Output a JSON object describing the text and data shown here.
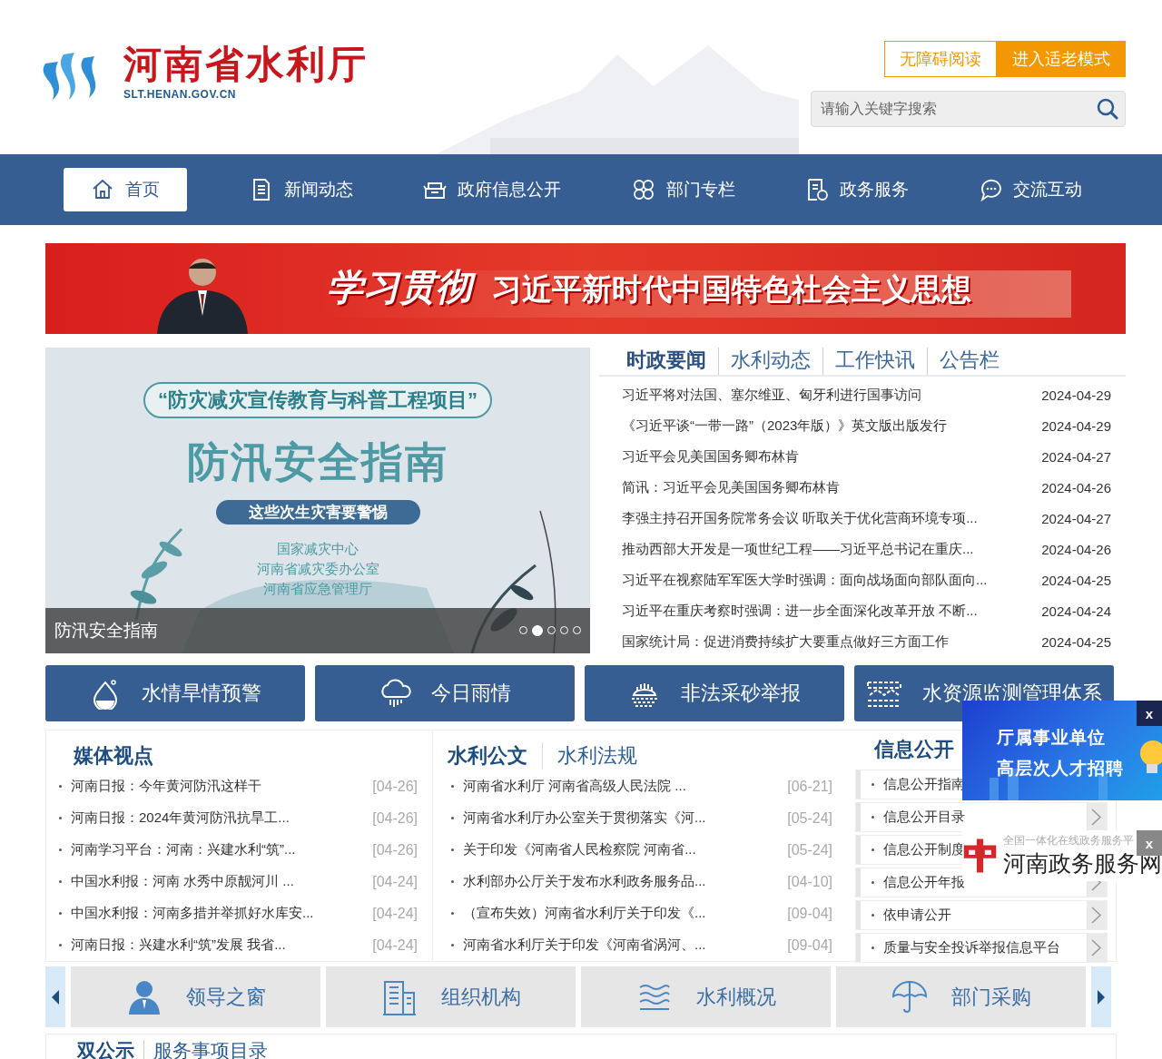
{
  "header": {
    "site_name": "河南省水利厅",
    "domain": "SLT.HENAN.GOV.CN",
    "buttons": [
      {
        "label": "无障碍阅读",
        "kind": "outline"
      },
      {
        "label": "进入适老模式",
        "kind": "filled"
      }
    ],
    "search": {
      "placeholder": "请输入关键字搜索"
    }
  },
  "nav": [
    {
      "label": "首页",
      "selected": true
    },
    {
      "label": "新闻动态",
      "selected": false
    },
    {
      "label": "政府信息公开",
      "selected": false
    },
    {
      "label": "部门专栏",
      "selected": false
    },
    {
      "label": "政务服务",
      "selected": false
    },
    {
      "label": "交流互动",
      "selected": false
    }
  ],
  "banner": {
    "calligraphy": "学习贯彻",
    "title": "习近平新时代中国特色社会主义思想"
  },
  "slideshow": {
    "poster": {
      "subtitle": "“防灾减灾宣传教育与科普工程项目”",
      "title": "防汛安全指南",
      "ribbon": "这些次生灾害要警惕",
      "issuers": [
        "国家减灾中心",
        "河南省减灾委办公室",
        "河南省应急管理厅"
      ]
    },
    "caption": "防汛安全指南",
    "dots": [
      {
        "selected": false
      },
      {
        "selected": true
      },
      {
        "selected": false
      },
      {
        "selected": false
      },
      {
        "selected": false
      }
    ]
  },
  "news": {
    "tabs": [
      {
        "label": "时政要闻",
        "selected": true
      },
      {
        "label": "水利动态",
        "selected": false
      },
      {
        "label": "工作快讯",
        "selected": false
      },
      {
        "label": "公告栏",
        "selected": false
      }
    ],
    "items": [
      {
        "title": "习近平将对法国、塞尔维亚、匈牙利进行国事访问",
        "date": "2024-04-29"
      },
      {
        "title": "《习近平谈“一带一路”（2023年版）》英文版出版发行",
        "date": "2024-04-29"
      },
      {
        "title": "习近平会见美国国务卿布林肯",
        "date": "2024-04-27"
      },
      {
        "title": "简讯：习近平会见美国国务卿布林肯",
        "date": "2024-04-26"
      },
      {
        "title": "李强主持召开国务院常务会议 听取关于优化营商环境专项...",
        "date": "2024-04-27"
      },
      {
        "title": "推动西部大开发是一项世纪工程——习近平总书记在重庆...",
        "date": "2024-04-26"
      },
      {
        "title": "习近平在视察陆军军医大学时强调：面向战场面向部队面向...",
        "date": "2024-04-25"
      },
      {
        "title": "习近平在重庆考察时强调：进一步全面深化改革开放 不断...",
        "date": "2024-04-24"
      },
      {
        "title": "国家统计局：促进消费持续扩大要重点做好三方面工作",
        "date": "2024-04-25"
      }
    ]
  },
  "quick_links": [
    "水情旱情预警",
    "今日雨情",
    "非法采砂举报",
    "水资源监测管理体系"
  ],
  "media": {
    "title": "媒体视点",
    "items": [
      {
        "title": "河南日报：今年黄河防汛这样干",
        "date": "[04-26]"
      },
      {
        "title": "河南日报：2024年黄河防汛抗旱工...",
        "date": "[04-26]"
      },
      {
        "title": "河南学习平台：河南：兴建水利“筑”...",
        "date": "[04-26]"
      },
      {
        "title": "中国水利报：河南 水秀中原靓河川 ...",
        "date": "[04-24]"
      },
      {
        "title": "中国水利报：河南多措并举抓好水库安...",
        "date": "[04-24]"
      },
      {
        "title": "河南日报：兴建水利“筑”发展 我省...",
        "date": "[04-24]"
      }
    ]
  },
  "documents": {
    "tabs": [
      {
        "label": "水利公文",
        "selected": true
      },
      {
        "label": "水利法规",
        "selected": false
      }
    ],
    "items": [
      {
        "title": "河南省水利厅 河南省高级人民法院 ...",
        "date": "[06-21]"
      },
      {
        "title": "河南省水利厅办公室关于贯彻落实《河...",
        "date": "[05-24]"
      },
      {
        "title": "关于印发《河南省人民检察院 河南省...",
        "date": "[05-24]"
      },
      {
        "title": "水利部办公厅关于发布水利政务服务品...",
        "date": "[04-10]"
      },
      {
        "title": "（宣布失效）河南省水利厅关于印发《...",
        "date": "[09-04]"
      },
      {
        "title": "河南省水利厅关于印发《河南省涡河、...",
        "date": "[09-04]"
      }
    ]
  },
  "disclosure": {
    "title": "信息公开",
    "items": [
      "信息公开指南",
      "信息公开目录",
      "信息公开制度",
      "信息公开年报",
      "依申请公开",
      "质量与安全投诉举报信息平台"
    ]
  },
  "carousel": {
    "items": [
      "领导之窗",
      "组织机构",
      "水利概况",
      "部门采购"
    ]
  },
  "services": {
    "tabs": [
      {
        "label": "双公示",
        "selected": true
      },
      {
        "label": "服务事项目录",
        "selected": false
      }
    ]
  },
  "ads": [
    {
      "kind": "recruit",
      "lines": [
        "厅属事业单位",
        "高层次人才招聘"
      ],
      "close": "x"
    },
    {
      "kind": "portal",
      "tagline": "全国一体化在线政务服务平",
      "name": "河南政务服务网",
      "close": "x"
    }
  ]
}
